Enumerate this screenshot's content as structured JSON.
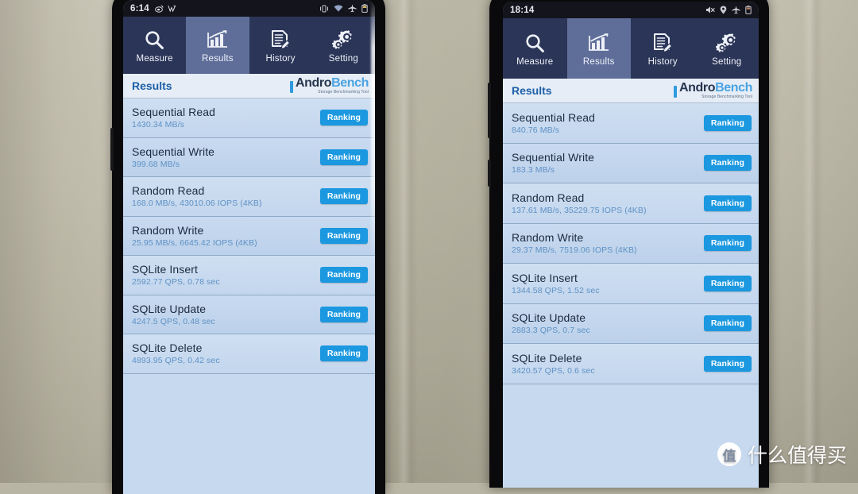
{
  "scene": {
    "description": "Two Android phones side by side running AndroBench storage benchmark results",
    "wall_color": "#bdb9a7"
  },
  "watermark": {
    "logo_char": "值",
    "text": "什么值得买"
  },
  "app": {
    "brand_name_part1": "Andro",
    "brand_name_part2": "Bench",
    "brand_tagline": "Storage Benchmarking Tool",
    "title": "Results",
    "tabs": [
      {
        "label": "Measure",
        "icon": "search-icon",
        "active": false
      },
      {
        "label": "Results",
        "icon": "bar-chart-icon",
        "active": true
      },
      {
        "label": "History",
        "icon": "document-pencil-icon",
        "active": false
      },
      {
        "label": "Setting",
        "icon": "gear-icon",
        "active": false
      }
    ],
    "ranking_label": "Ranking"
  },
  "colors": {
    "tab_bar": "#2b3557",
    "tab_active": "#5f6e99",
    "title_text": "#1d5fa8",
    "row_bg": "#c6d9ef",
    "row_name_text": "#1b2b40",
    "row_value_text": "#5e91c6",
    "ranking_button": "#1b98e0",
    "status_bar": "#13141c"
  },
  "phone_left": {
    "status": {
      "clock": "6:14",
      "left_icons": [
        "weibo-icon",
        "wechat-icon"
      ],
      "right_icons": [
        "vibrate-icon",
        "wifi-icon",
        "airplane-icon",
        "battery-icon"
      ]
    },
    "results": [
      {
        "name": "Sequential Read",
        "value": "1430.34 MB/s"
      },
      {
        "name": "Sequential Write",
        "value": "399.68 MB/s"
      },
      {
        "name": "Random Read",
        "value": "168.0 MB/s, 43010.06 IOPS (4KB)"
      },
      {
        "name": "Random Write",
        "value": "25.95 MB/s, 6645.42 IOPS (4KB)"
      },
      {
        "name": "SQLite Insert",
        "value": "2592.77 QPS, 0.78 sec"
      },
      {
        "name": "SQLite Update",
        "value": "4247.5 QPS, 0.48 sec"
      },
      {
        "name": "SQLite Delete",
        "value": "4893.95 QPS, 0.42 sec"
      }
    ]
  },
  "phone_right": {
    "status": {
      "clock": "18:14",
      "left_icons": [],
      "right_icons": [
        "mute-icon",
        "location-icon",
        "airplane-icon",
        "battery-icon"
      ]
    },
    "results": [
      {
        "name": "Sequential Read",
        "value": "840.76 MB/s"
      },
      {
        "name": "Sequential Write",
        "value": "183.3 MB/s"
      },
      {
        "name": "Random Read",
        "value": "137.61 MB/s, 35229.75 IOPS (4KB)"
      },
      {
        "name": "Random Write",
        "value": "29.37 MB/s, 7519.06 IOPS (4KB)"
      },
      {
        "name": "SQLite Insert",
        "value": "1344.58 QPS, 1.52 sec"
      },
      {
        "name": "SQLite Update",
        "value": "2883.3 QPS, 0.7 sec"
      },
      {
        "name": "SQLite Delete",
        "value": "3420.57 QPS, 0.6 sec"
      }
    ]
  }
}
